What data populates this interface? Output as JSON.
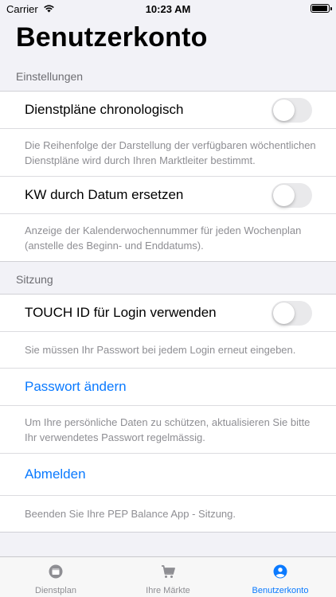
{
  "status_bar": {
    "carrier": "Carrier",
    "time": "10:23 AM"
  },
  "page_title": "Benutzerkonto",
  "sections": {
    "einstellungen": {
      "header": "Einstellungen",
      "row1_label": "Dienstpläne chronologisch",
      "row1_footer": "Die Reihenfolge der Darstellung der verfügbaren wöchentlichen Dienstpläne wird durch Ihren Marktleiter bestimmt.",
      "row2_label": "KW durch Datum ersetzen",
      "row2_footer": "Anzeige der Kalenderwochennummer für jeden Wochenplan (anstelle des Beginn- und Enddatums)."
    },
    "sitzung": {
      "header": "Sitzung",
      "touch_label": "TOUCH ID für Login verwenden",
      "touch_footer": "Sie müssen Ihr Passwort bei jedem Login erneut eingeben.",
      "password_label": "Passwort ändern",
      "password_footer": "Um Ihre persönliche Daten zu schützen, aktualisieren Sie bitte Ihr verwendetes Passwort regelmässig.",
      "logout_label": "Abmelden",
      "logout_footer": "Beenden Sie Ihre PEP Balance App - Sitzung."
    }
  },
  "toggles": {
    "chronologisch": false,
    "kw_datum": false,
    "touch_id": false
  },
  "tab_bar": {
    "tabs": [
      {
        "label": "Dienstplan",
        "icon": "calendar-icon",
        "active": false
      },
      {
        "label": "Ihre Märkte",
        "icon": "cart-icon",
        "active": false
      },
      {
        "label": "Benutzerkonto",
        "icon": "person-icon",
        "active": true
      }
    ]
  },
  "colors": {
    "accent": "#0a7aff",
    "background": "#f2f2f7",
    "footer_text": "#8e8e93",
    "toggle_off": "#e9e9eb"
  }
}
